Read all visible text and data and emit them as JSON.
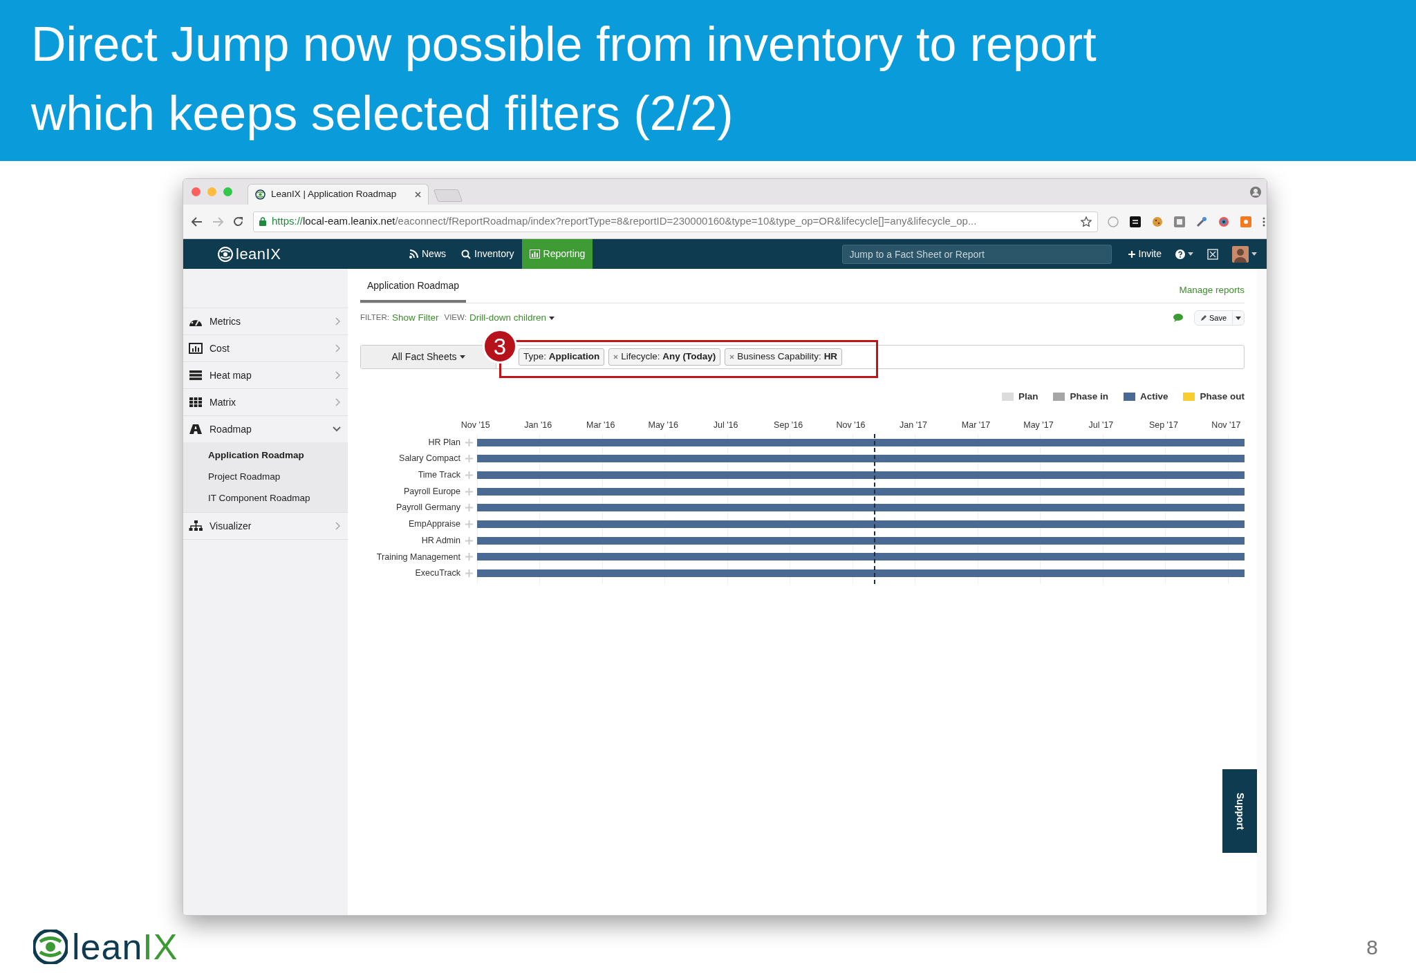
{
  "slide": {
    "title": "Direct Jump now possible from inventory to report\nwhich keeps selected filters (2/2)",
    "logo_lean": "lean",
    "logo_ix": "IX",
    "page_number": "8"
  },
  "browser": {
    "tab_title": "LeanIX | Application Roadmap",
    "url": {
      "scheme": "https://",
      "host": "local-eam.leanix.net",
      "path": "/eaconnect/fReportRoadmap/index?reportType=8&reportID=230000160&type=10&type_op=OR&lifecycle[]=any&lifecycle_op..."
    }
  },
  "app": {
    "logo": "leanIX",
    "nav": [
      {
        "label": "News",
        "selected": false
      },
      {
        "label": "Inventory",
        "selected": false
      },
      {
        "label": "Reporting",
        "selected": true
      }
    ],
    "search": {
      "placeholder": "Jump to a Fact Sheet or Report"
    },
    "invite": "Invite"
  },
  "sidebar": {
    "items": [
      {
        "label": "Metrics",
        "expanded": false
      },
      {
        "label": "Cost",
        "expanded": false
      },
      {
        "label": "Heat map",
        "expanded": false
      },
      {
        "label": "Matrix",
        "expanded": false
      },
      {
        "label": "Roadmap",
        "expanded": true,
        "children": [
          {
            "label": "Application Roadmap",
            "selected": true
          },
          {
            "label": "Project Roadmap",
            "selected": false
          },
          {
            "label": "IT Component Roadmap",
            "selected": false
          }
        ]
      },
      {
        "label": "Visualizer",
        "expanded": false
      }
    ]
  },
  "report": {
    "tab": "Application Roadmap",
    "manage": "Manage reports",
    "filter_label": "FILTER:",
    "filter_link": "Show Filter",
    "view_label": "VIEW:",
    "view_value": "Drill-down children",
    "save": "Save",
    "scope": "All Fact Sheets",
    "tags": [
      {
        "text": "Type: **Application**",
        "removable": false
      },
      {
        "text": "Lifecycle: **Any (Today)**",
        "removable": true
      },
      {
        "text": "Business Capability: **HR**",
        "removable": true
      }
    ],
    "callout": "3"
  },
  "legend": [
    {
      "label": "Plan",
      "color": "#dcdcdc"
    },
    {
      "label": "Phase in",
      "color": "#a6a6a6"
    },
    {
      "label": "Active",
      "color": "#4b6a93"
    },
    {
      "label": "Phase out",
      "color": "#f8cd2e"
    }
  ],
  "timeline": {
    "months": [
      "Nov '15",
      "Jan '16",
      "Mar '16",
      "May '16",
      "Jul '16",
      "Sep '16",
      "Nov '16",
      "Jan '17",
      "Mar '17",
      "May '17",
      "Jul '17",
      "Sep '17",
      "Nov '17"
    ],
    "rows": [
      {
        "name": "HR Plan"
      },
      {
        "name": "Salary Compact"
      },
      {
        "name": "Time Track"
      },
      {
        "name": "Payroll Europe"
      },
      {
        "name": "Payroll Germany"
      },
      {
        "name": "EmpAppraise"
      },
      {
        "name": "HR Admin"
      },
      {
        "name": "Training Management"
      },
      {
        "name": "ExecuTrack"
      }
    ]
  },
  "support": "Support"
}
